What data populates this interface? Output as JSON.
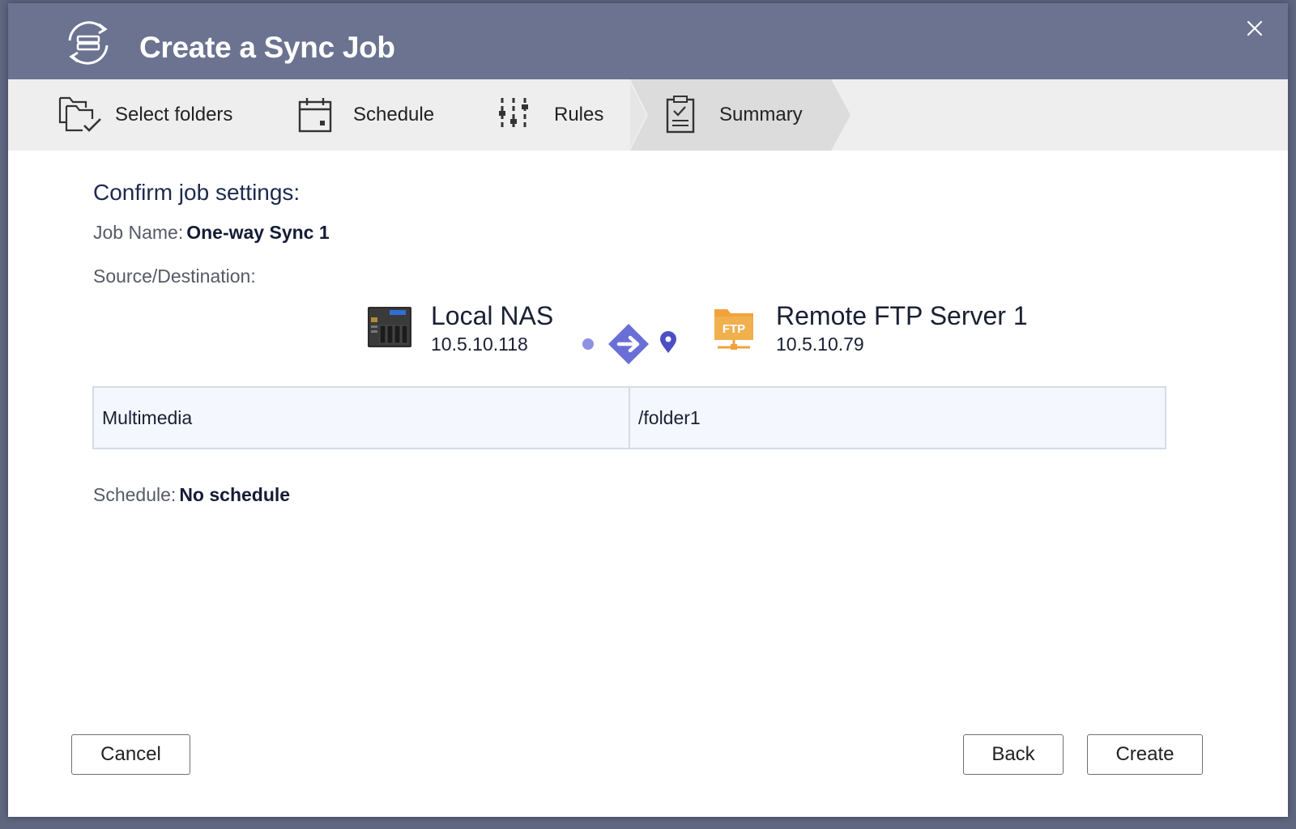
{
  "dialog": {
    "title": "Create a Sync Job",
    "title_icon": "sync-job-icon",
    "close_icon": "close-icon"
  },
  "steps": [
    {
      "label": "Select folders",
      "icon": "select-folders-icon",
      "active": false
    },
    {
      "label": "Schedule",
      "icon": "calendar-icon",
      "active": false
    },
    {
      "label": "Rules",
      "icon": "rules-sliders-icon",
      "active": false
    },
    {
      "label": "Summary",
      "icon": "summary-clipboard-icon",
      "active": true
    }
  ],
  "summary": {
    "heading": "Confirm job settings:",
    "job_name_label": "Job Name:",
    "job_name_value": "One-way Sync 1",
    "source_destination_label": "Source/Destination:",
    "source": {
      "name": "Local NAS",
      "ip": "10.5.10.118",
      "icon": "nas-icon"
    },
    "destination": {
      "name": "Remote FTP Server 1",
      "ip": "10.5.10.79",
      "icon": "ftp-server-icon"
    },
    "direction_icon": "one-way-arrow-icon",
    "folders": [
      {
        "source": "Multimedia",
        "destination": "/folder1"
      }
    ],
    "schedule_label": "Schedule:",
    "schedule_value": "No schedule"
  },
  "buttons": {
    "cancel": "Cancel",
    "back": "Back",
    "create": "Create"
  },
  "colors": {
    "titlebar": "#6b7391",
    "accent_arrow": "#6a6fd6",
    "ftp_orange": "#f2a23a"
  }
}
